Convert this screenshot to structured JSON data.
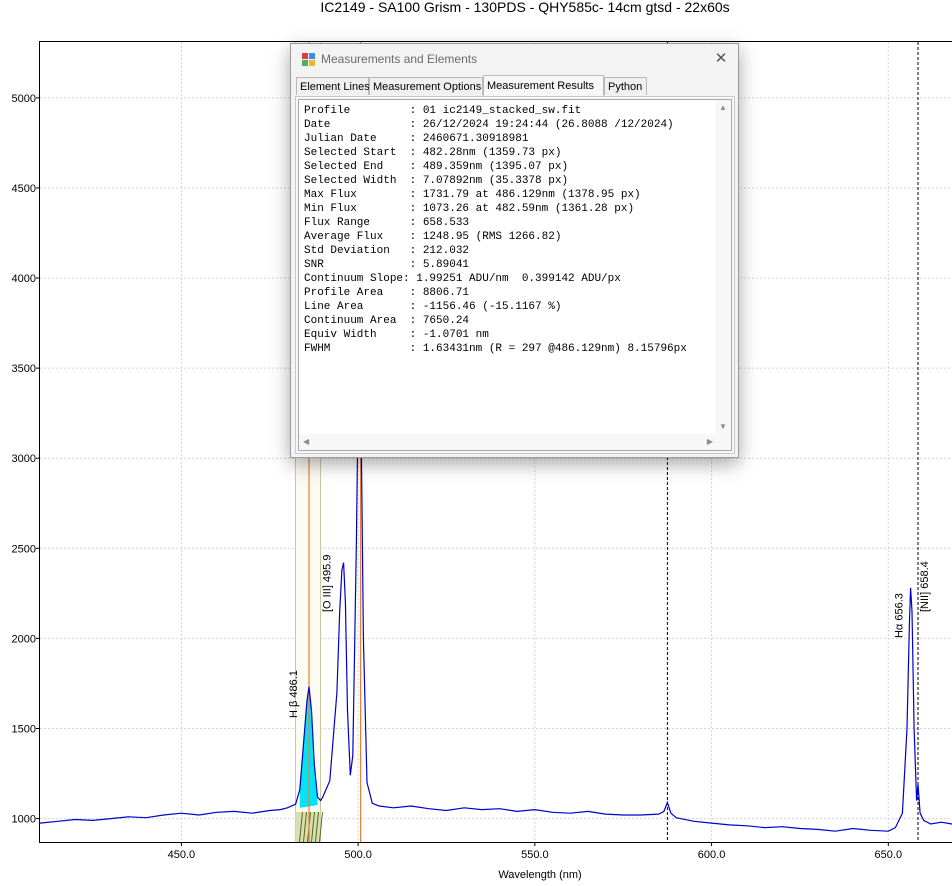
{
  "chart_data": {
    "type": "line",
    "title": "IC2149 - SA100 Grism - 130PDS - QHY585c- 14cm gtsd - 22x60s",
    "xlabel": "Wavelength (nm)",
    "ylabel": "",
    "xlim": [
      410,
      670
    ],
    "ylim": [
      870,
      5310
    ],
    "x_ticks": [
      "450.0",
      "500.0",
      "550.0",
      "600.0",
      "650.0"
    ],
    "y_ticks": [
      "1000",
      "1500",
      "2000",
      "2500",
      "3000",
      "3500",
      "4000",
      "4500",
      "5000"
    ],
    "grid": true,
    "series_color": "#0000cc",
    "series": [
      {
        "x": [
          410,
          415,
          420,
          425,
          430,
          435,
          440,
          445,
          450,
          455,
          460,
          465,
          470,
          475,
          478,
          480,
          482.3,
          483.5,
          484.5,
          485.5,
          486.1,
          486.8,
          487.6,
          488.5,
          489.4,
          490,
          492,
          494,
          494.8,
          495.4,
          495.9,
          496.4,
          497,
          497.8,
          498.5,
          499.5,
          500.2,
          500.8,
          501.5,
          502.5,
          504,
          506,
          510,
          515,
          520,
          525,
          530,
          535,
          540,
          545,
          550,
          555,
          560,
          565,
          570,
          575,
          580,
          585,
          586.5,
          587.5,
          588.5,
          590,
          595,
          600,
          605,
          610,
          615,
          620,
          625,
          630,
          635,
          640,
          645,
          650,
          652,
          654,
          655.3,
          656,
          656.3,
          656.7,
          657.3,
          658,
          658.4,
          659,
          660,
          662,
          665,
          668,
          670
        ],
        "y": [
          975,
          985,
          995,
          990,
          1000,
          1010,
          1005,
          1020,
          1030,
          1020,
          1035,
          1040,
          1030,
          1045,
          1050,
          1060,
          1080,
          1160,
          1400,
          1650,
          1732,
          1600,
          1300,
          1120,
          1100,
          1120,
          1210,
          1700,
          2150,
          2380,
          2420,
          2200,
          1600,
          1240,
          1350,
          2500,
          3600,
          3300,
          2000,
          1200,
          1085,
          1070,
          1060,
          1070,
          1055,
          1045,
          1060,
          1050,
          1055,
          1040,
          1050,
          1035,
          1030,
          1040,
          1025,
          1020,
          1020,
          1025,
          1040,
          1090,
          1030,
          1005,
          985,
          975,
          965,
          960,
          950,
          955,
          945,
          940,
          930,
          945,
          935,
          930,
          950,
          1030,
          1500,
          2100,
          2280,
          2150,
          1500,
          1100,
          1190,
          1030,
          990,
          970,
          980,
          970,
          950
        ]
      }
    ],
    "annotations": [
      {
        "text": "H β 486.1",
        "x": 486.1
      },
      {
        "text": "[O III] 495.9",
        "x": 495.9
      },
      {
        "text": "Hα 656.3",
        "x": 656.3
      },
      {
        "text": "[NII] 658.4",
        "x": 658.4
      }
    ],
    "markers": {
      "orange_lines_x": [
        486.1,
        500.7
      ],
      "dashed_lines_x": [
        587.5,
        658.4
      ],
      "selection_x": [
        482.28,
        489.359
      ],
      "marker_color": "#e8803a",
      "fill_color": "#00e5f5",
      "selection_color": "#d8dfb0"
    }
  },
  "dialog": {
    "title": "Measurements and Elements",
    "tabs": [
      "Element Lines",
      "Measurement Options",
      "Measurement Results",
      "Python"
    ],
    "results": [
      "Profile         : 01 ic2149_stacked_sw.fit",
      "Date            : 26/12/2024 19:24:44 (26.8088 /12/2024)",
      "Julian Date     : 2460671.30918981",
      "Selected Start  : 482.28nm (1359.73 px)",
      "Selected End    : 489.359nm (1395.07 px)",
      "Selected Width  : 7.07892nm (35.3378 px)",
      "Max Flux        : 1731.79 at 486.129nm (1378.95 px)",
      "Min Flux        : 1073.26 at 482.59nm (1361.28 px)",
      "Flux Range      : 658.533",
      "Average Flux    : 1248.95 (RMS 1266.82)",
      "Std Deviation   : 212.032",
      "SNR             : 5.89041",
      "Continuum Slope: 1.99251 ADU/nm  0.399142 ADU/px",
      "Profile Area    : 8806.71",
      "Line Area       : -1156.46 (-15.1167 %)",
      "Continuum Area  : 7650.24",
      "Equiv Width     : -1.0701 nm",
      "FWHM            : 1.63431nm (R = 297 @486.129nm) 8.15796px"
    ],
    "close_icon": "close-icon",
    "app_icon": "app-icon"
  }
}
